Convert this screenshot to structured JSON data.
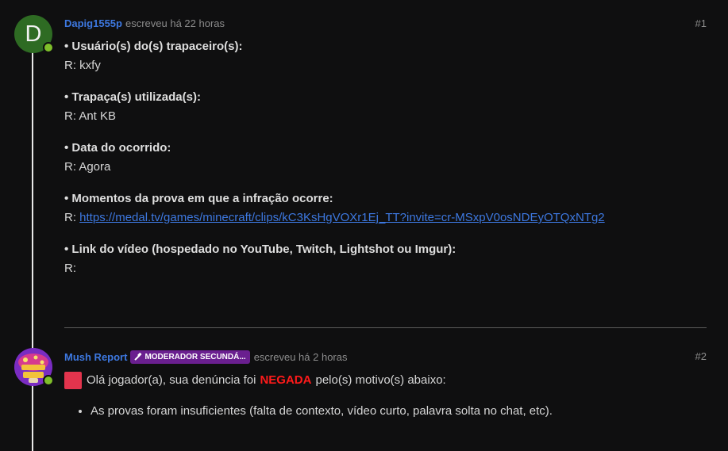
{
  "posts": [
    {
      "avatar_letter": "D",
      "author": "Dapig1555p",
      "meta": "escreveu há 22 horas",
      "number": "#1",
      "fields": [
        {
          "label": "• Usuário(s) do(s) trapaceiro(s):",
          "value": "R: kxfy"
        },
        {
          "label": "• Trapaça(s) utilizada(s):",
          "value": "R: Ant KB"
        },
        {
          "label": "• Data do ocorrido:",
          "value": "R: Agora"
        },
        {
          "label": "• Momentos da prova em que a infração ocorre:",
          "value_prefix": "R: ",
          "link": "https://medal.tv/games/minecraft/clips/kC3KsHgVOXr1Ej_TT?invite=cr-MSxpV0osNDEyOTQxNTg2"
        },
        {
          "label": "• Link do vídeo (hospedado no YouTube, Twitch, Lightshot ou Imgur):",
          "value": "R:"
        }
      ]
    },
    {
      "author": "Mush Report",
      "role_badge": "MODERADOR SECUNDÁ...",
      "meta": "escreveu há 2 horas",
      "number": "#2",
      "intro_before": "Olá jogador(a), sua denúncia foi",
      "intro_highlight": "NEGADA",
      "intro_after": "pelo(s) motivo(s) abaixo:",
      "reasons": [
        "As provas foram insuficientes (falta de contexto, vídeo curto, palavra solta no chat, etc)."
      ]
    }
  ],
  "colors": {
    "background": "#0f0f10",
    "author_link": "#3d78e0",
    "denied": "#ff1a1a",
    "badge": "#6a1f8f",
    "online": "#7fbf2a"
  }
}
